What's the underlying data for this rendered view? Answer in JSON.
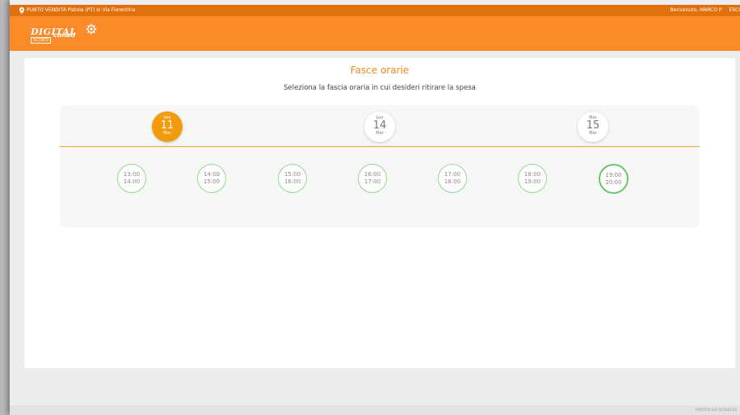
{
  "topbar": {
    "store": "PUNTO VENDITA Pistoia (PT) in Via Fiorentina",
    "welcome": "Benvenuto, MARCO P.",
    "logout": "ESCI"
  },
  "logo": {
    "line1": "DIGITAL",
    "line2": "conad",
    "line3": "SCONTI"
  },
  "page": {
    "title": "Fasce orarie",
    "subtitle": "Seleziona la fascia oraria in cui desideri ritirare la spesa"
  },
  "days": [
    {
      "weekday": "Ven",
      "day": "11",
      "month": "Mar",
      "active": true
    },
    {
      "weekday": "Lun",
      "day": "14",
      "month": "Mar",
      "active": false
    },
    {
      "weekday": "Mar",
      "day": "15",
      "month": "Mar",
      "active": false
    }
  ],
  "slots": [
    {
      "start": "13:00",
      "end": "14:00"
    },
    {
      "start": "14:00",
      "end": "15:00"
    },
    {
      "start": "15:00",
      "end": "16:00"
    },
    {
      "start": "16:00",
      "end": "17:00"
    },
    {
      "start": "17:00",
      "end": "18:00"
    },
    {
      "start": "18:00",
      "end": "19:00"
    },
    {
      "start": "19:00",
      "end": "20:00",
      "selected": true
    }
  ],
  "footer": {
    "text": "PARTITA IVA 01508110"
  },
  "colors": {
    "topbar": "#e2700f",
    "brand": "#fb8a28",
    "accent": "#f29b0c",
    "slot_border": "#8fd98c"
  }
}
